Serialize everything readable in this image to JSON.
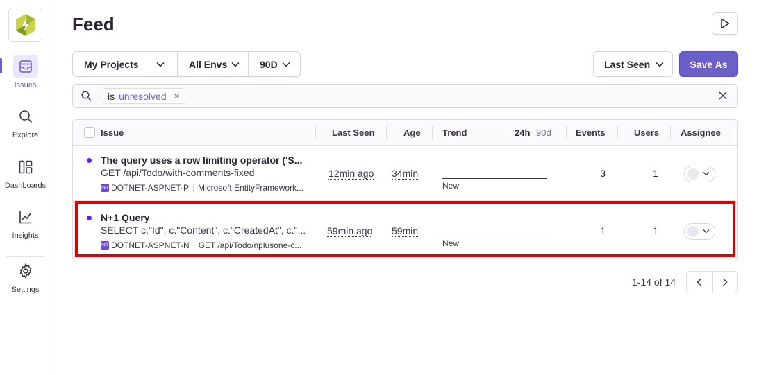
{
  "page": {
    "title": "Feed"
  },
  "colors": {
    "accent": "#6c5fc7",
    "unresolved_dot": "#6c1fe0",
    "highlight": "#e00000"
  },
  "sidebar": {
    "items": [
      {
        "label": "Issues",
        "icon": "inbox-icon",
        "active": true
      },
      {
        "label": "Explore",
        "icon": "search-icon"
      },
      {
        "label": "Dashboards",
        "icon": "dashboard-icon"
      },
      {
        "label": "Insights",
        "icon": "chart-icon"
      },
      {
        "label": "Settings",
        "icon": "gear-icon"
      }
    ]
  },
  "filters": {
    "project": "My Projects",
    "env": "All Envs",
    "period": "90D"
  },
  "sort": {
    "label": "Last Seen"
  },
  "actions": {
    "save_as": "Save As"
  },
  "search": {
    "token_key": "is",
    "token_value": "unresolved"
  },
  "table": {
    "headers": {
      "issue": "Issue",
      "last_seen": "Last Seen",
      "age": "Age",
      "trend": "Trend",
      "trend_24h": "24h",
      "trend_90d": "90d",
      "events": "Events",
      "users": "Users",
      "assignee": "Assignee"
    },
    "rows": [
      {
        "title": "The query uses a row limiting operator ('S...",
        "subtitle": "GET /api/Todo/with-comments-fixed",
        "project": "DOTNET-ASPNET-P",
        "culprit": "Microsoft.EntityFramework...",
        "last_seen": "12min ago",
        "age": "34min",
        "trend": "New",
        "events": "3",
        "users": "1"
      },
      {
        "title": "N+1 Query",
        "subtitle": "SELECT c.\"Id\", c.\"Content\", c.\"CreatedAt\", c.\"...",
        "project": "DOTNET-ASPNET-N",
        "culprit": "GET /api/Todo/nplusone-c...",
        "last_seen": "59min ago",
        "age": "59min",
        "trend": "New",
        "events": "1",
        "users": "1"
      }
    ]
  },
  "pagination": {
    "text": "1-14 of 14"
  }
}
